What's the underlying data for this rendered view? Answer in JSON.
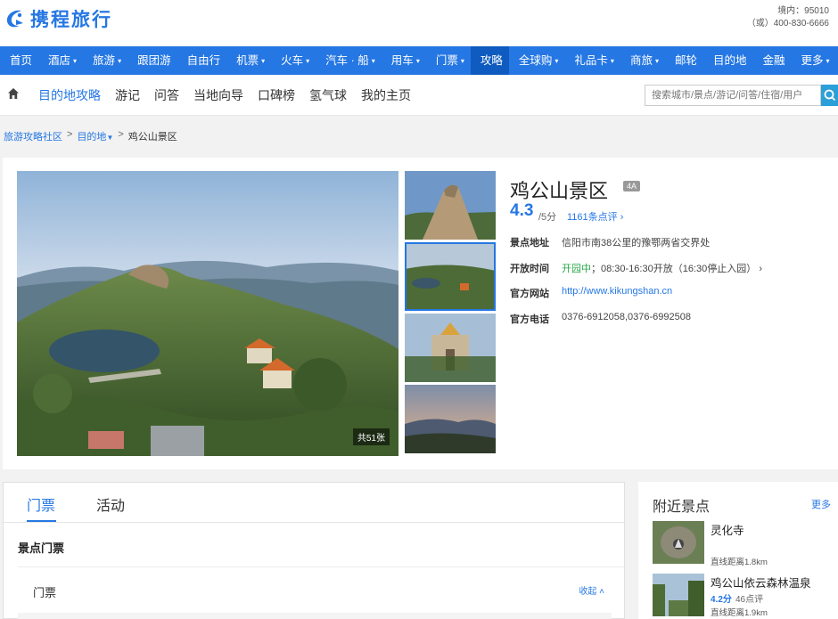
{
  "header": {
    "logo_text": "携程旅行",
    "hotline_domestic": "境内：95010",
    "hotline_alt": "（或）400-830-6666"
  },
  "main_nav": [
    {
      "label": "首页",
      "dropdown": false
    },
    {
      "label": "酒店",
      "dropdown": true
    },
    {
      "label": "旅游",
      "dropdown": true
    },
    {
      "label": "跟团游",
      "dropdown": false
    },
    {
      "label": "自由行",
      "dropdown": false
    },
    {
      "label": "机票",
      "dropdown": true
    },
    {
      "label": "火车",
      "dropdown": true
    },
    {
      "label": "汽车 · 船",
      "dropdown": true
    },
    {
      "label": "用车",
      "dropdown": true
    },
    {
      "label": "门票",
      "dropdown": true
    },
    {
      "label": "攻略",
      "dropdown": false,
      "active": true
    },
    {
      "label": "全球购",
      "dropdown": true
    },
    {
      "label": "礼品卡",
      "dropdown": true
    },
    {
      "label": "商旅",
      "dropdown": true
    },
    {
      "label": "邮轮",
      "dropdown": false
    },
    {
      "label": "目的地",
      "dropdown": false
    },
    {
      "label": "金融",
      "dropdown": false
    },
    {
      "label": "更多",
      "dropdown": true
    }
  ],
  "sub_nav": {
    "items": [
      "目的地攻略",
      "游记",
      "问答",
      "当地向导",
      "口碑榜",
      "氢气球",
      "我的主页"
    ],
    "active_index": 0,
    "search_placeholder": "搜索城市/景点/游记/问答/住宿/用户"
  },
  "breadcrumb": {
    "community": "旅游攻略社区",
    "destination": "目的地",
    "current": "鸡公山景区"
  },
  "poi": {
    "title": "鸡公山景区",
    "level": "4A",
    "score": "4.3",
    "score_total": "/5分",
    "review_count": "1161条点评",
    "photo_count": "共51张",
    "address_label": "景点地址",
    "address": "信阳市南38公里的豫鄂两省交界处",
    "hours_label": "开放时间",
    "open_status": "开园中",
    "hours": "；08:30-16:30开放（16:30停止入园）",
    "website_label": "官方网站",
    "website": "http://www.kikungshan.cn",
    "phone_label": "官方电话",
    "phone": "0376-6912058,0376-6992508"
  },
  "tabs": {
    "items": [
      "门票",
      "活动"
    ],
    "active_index": 0,
    "section_title": "景点门票",
    "ticket_row": "门票",
    "collapse": "收起"
  },
  "nearby": {
    "title": "附近景点",
    "more": "更多",
    "items": [
      {
        "name": "灵化寺",
        "score": "",
        "reviews": "",
        "distance": "直线距离1.8km"
      },
      {
        "name": "鸡公山依云森林温泉",
        "score": "4.2分",
        "reviews": "46点评",
        "distance": "直线距离1.9km"
      }
    ]
  },
  "colors": {
    "brand_blue": "#2577e3",
    "nav_active": "#0f5bbf",
    "open_green": "#2aa748"
  }
}
